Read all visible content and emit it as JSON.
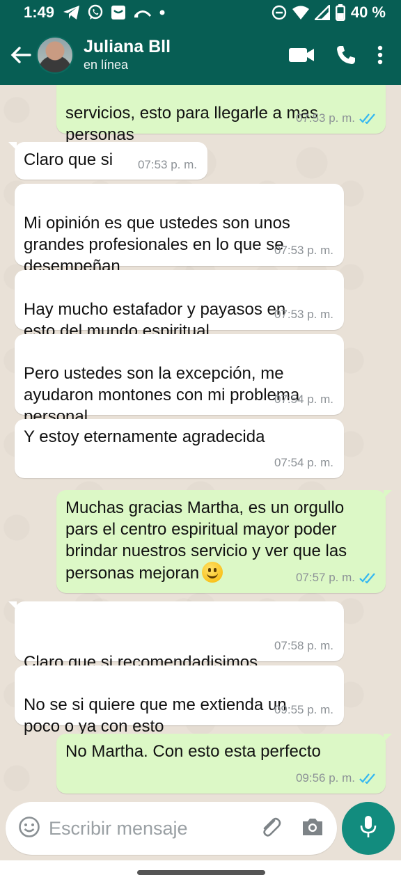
{
  "status_bar": {
    "time": "1:49",
    "battery": "40 %"
  },
  "header": {
    "contact_name": "Juliana Bll",
    "presence": "en línea"
  },
  "messages": [
    {
      "dir": "out",
      "text": "servicios, esto para llegarle a mas\npersonas",
      "time": "07:53 p. m.",
      "read": true
    },
    {
      "dir": "in",
      "text": "Claro que si",
      "time": "07:53 p. m."
    },
    {
      "dir": "in",
      "text": "Mi opinión es que ustedes son unos\ngrandes profesionales en lo que se\ndesempeñan",
      "time": "07:53 p. m."
    },
    {
      "dir": "in",
      "text": "Hay mucho estafador y payasos en\nesto del mundo espiritual",
      "time": "07:53 p. m."
    },
    {
      "dir": "in",
      "text": "Pero ustedes son la excepción, me\nayudaron montones con mi problema\npersonal",
      "time": "07:54 p. m."
    },
    {
      "dir": "in",
      "text": "Y estoy eternamente agradecida",
      "time": "07:54 p. m."
    },
    {
      "dir": "out",
      "text": "Muchas gracias Martha, es un orgullo\npars el centro espiritual mayor poder\nbrindar nuestros servicio y ver que las\npersonas mejoran",
      "time": "07:57 p. m.",
      "read": true,
      "emoji": "slightly-smiling-face"
    },
    {
      "dir": "in",
      "text": "Claro que si recomendadisimos\nMaestro",
      "time": "07:58 p. m."
    },
    {
      "dir": "in",
      "text": "No se si quiere que me extienda un\npoco o ya con esto",
      "time": "09:55 p. m."
    },
    {
      "dir": "out",
      "text": "No Martha. Con esto esta perfecto",
      "time": "09:56 p. m.",
      "read": true
    }
  ],
  "composer": {
    "placeholder": "Escribir mensaje"
  },
  "colors": {
    "header": "#075e54",
    "outgoing_bubble": "#dcf8c6",
    "incoming_bubble": "#ffffff",
    "read_ticks": "#34b7f1",
    "mic_button": "#128c7e"
  }
}
